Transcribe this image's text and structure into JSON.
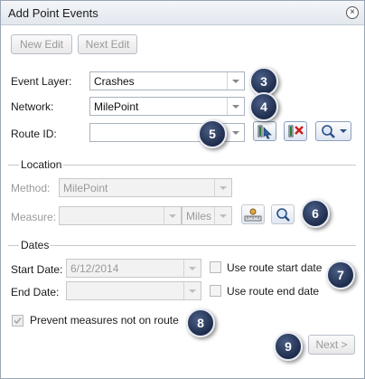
{
  "window": {
    "title": "Add Point Events",
    "close_icon": "close-icon"
  },
  "toolbar": {
    "new_edit_label": "New Edit",
    "next_edit_label": "Next Edit"
  },
  "event_layer": {
    "label": "Event Layer:",
    "value": "Crashes"
  },
  "network": {
    "label": "Network:",
    "value": "MilePoint"
  },
  "route_id": {
    "label": "Route ID:",
    "value": ""
  },
  "location": {
    "section_title": "Location",
    "method": {
      "label": "Method:",
      "value": "MilePoint"
    },
    "measure": {
      "label": "Measure:",
      "value": "",
      "units": "Miles"
    }
  },
  "dates": {
    "section_title": "Dates",
    "start_date": {
      "label": "Start Date:",
      "value": "6/12/2014",
      "checkbox_label": "Use route start date",
      "checked": false
    },
    "end_date": {
      "label": "End Date:",
      "value": "",
      "checkbox_label": "Use route end date",
      "checked": false
    }
  },
  "prevent_measures": {
    "label": "Prevent measures not on route",
    "checked": true
  },
  "footer": {
    "next_label": "Next >"
  },
  "callouts": [
    "3",
    "4",
    "5",
    "6",
    "7",
    "8",
    "9"
  ],
  "colors": {
    "accent": "#2a3b60",
    "title_bg": "#e6ebf1",
    "disabled_text": "#9a9a9a"
  }
}
